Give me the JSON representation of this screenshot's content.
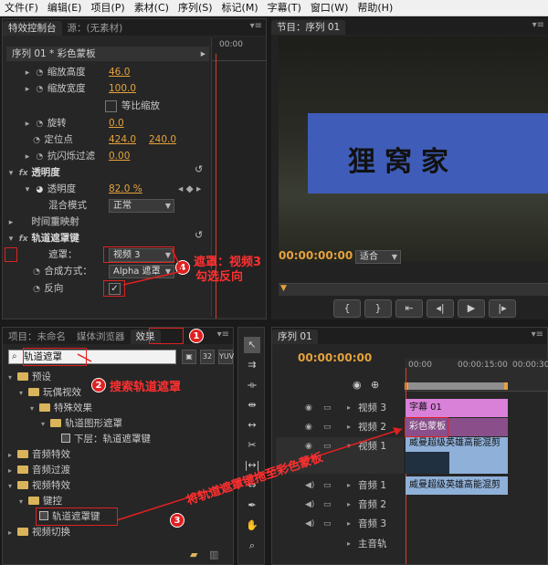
{
  "menu": [
    "文件(F)",
    "编辑(E)",
    "项目(P)",
    "素材(C)",
    "序列(S)",
    "标记(M)",
    "字幕(T)",
    "窗口(W)",
    "帮助(H)"
  ],
  "effect_controls": {
    "tabs": [
      "特效控制台",
      "源：(无素材)"
    ],
    "sequence": "序列 01 * 彩色蒙板",
    "ruler_time": "00:00",
    "rows": {
      "scale_height": {
        "label": "缩放高度",
        "value": "46.0"
      },
      "scale_width": {
        "label": "缩放宽度",
        "value": "100.0"
      },
      "uniform": {
        "label": "等比缩放"
      },
      "rotation": {
        "label": "旋转",
        "value": "0.0"
      },
      "anchor": {
        "label": "定位点",
        "x": "424.0",
        "y": "240.0"
      },
      "antiflicker": {
        "label": "抗闪烁过滤",
        "value": "0.00"
      },
      "opacity_section": "透明度",
      "opacity": {
        "label": "透明度",
        "value": "82.0 %"
      },
      "blend": {
        "label": "混合模式",
        "value": "正常"
      },
      "time_remap": "时间重映射",
      "track_matte": "轨道遮罩键",
      "matte": {
        "label": "遮罩：",
        "value": "视频 3"
      },
      "composite": {
        "label": "合成方式：",
        "value": "Alpha 遮罩"
      },
      "reverse": {
        "label": "反向",
        "check": "✓"
      }
    }
  },
  "program_monitor": {
    "tab": "节目：序列 01",
    "overlay_text": "狸窝家",
    "timecode": "00:00:00:00",
    "zoom": "适合"
  },
  "effects_panel": {
    "tabs": [
      "项目：未命名",
      "媒体浏览器",
      "效果"
    ],
    "search": "轨道遮罩",
    "tools": [
      "32",
      "YUV"
    ],
    "tree": [
      "预设",
      "玩偶视效",
      "特殊效果",
      "轨道图形遮罩",
      "下层：轨道遮罩键",
      "音频特效",
      "音频过渡",
      "视频特效",
      "键控",
      "轨道遮罩键",
      "视频切换"
    ]
  },
  "timeline": {
    "tab": "序列 01",
    "timecode": "00:00:00:00",
    "ruler": [
      "00:00",
      "00:00:15:00",
      "00:00:30:00"
    ],
    "tracks": [
      "视频 3",
      "视频 2",
      "视频 1",
      "音频 1",
      "音频 2",
      "音频 3",
      "主音轨"
    ],
    "clips": {
      "title": "字幕 01",
      "matte": "彩色蒙板",
      "video": "威曼超级英雄高能混剪",
      "audio": "威曼超级英雄高能混剪"
    }
  },
  "annotations": {
    "a1": "1",
    "a2": "2",
    "t2": "搜索轨道遮罩",
    "a3": "3",
    "t3": "将轨道遮罩键拖至彩色蒙板",
    "a4": "4",
    "t4a": "遮罩：视频3",
    "t4b": "勾选反向"
  },
  "colors": {
    "accent": "#e6a23c",
    "annotation": "#e02020",
    "title_clip": "#d980d9",
    "matte_clip": "#8a4f8a",
    "video_clip": "#8fb0d8"
  }
}
